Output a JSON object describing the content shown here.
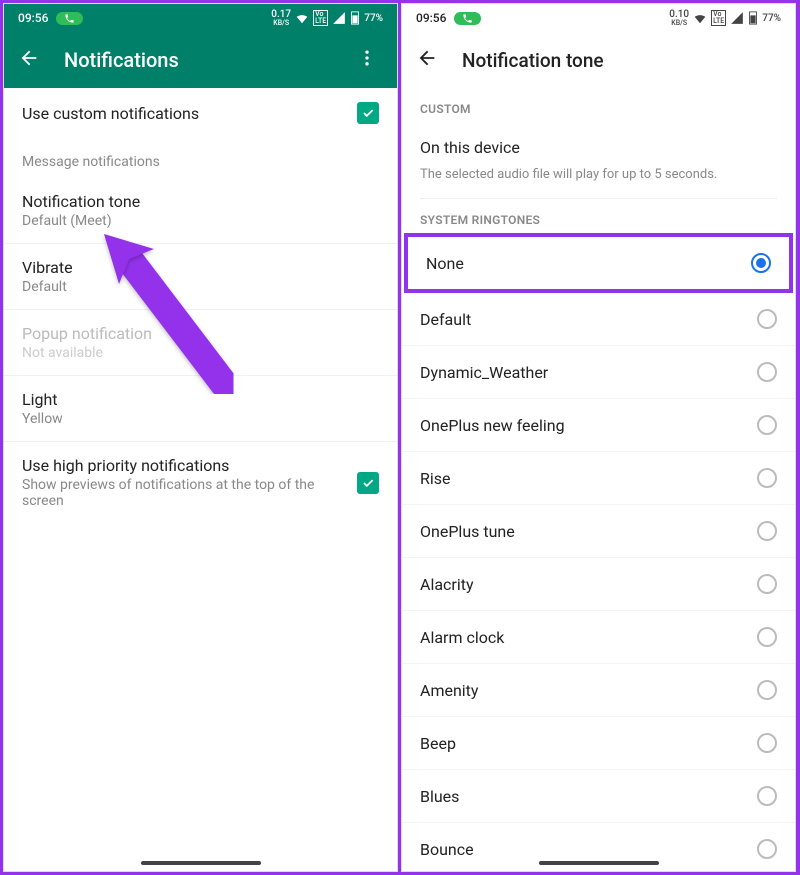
{
  "left": {
    "status": {
      "time": "09:56",
      "kbs": "0.17",
      "kbs_unit": "KB/S",
      "battery": "77%"
    },
    "appbar": {
      "title": "Notifications"
    },
    "useCustom": {
      "label": "Use custom notifications",
      "checked": true
    },
    "section1": "Message notifications",
    "items": [
      {
        "primary": "Notification tone",
        "secondary": "Default (Meet)",
        "disabled": false
      },
      {
        "primary": "Vibrate",
        "secondary": "Default",
        "disabled": false
      },
      {
        "primary": "Popup notification",
        "secondary": "Not available",
        "disabled": true
      },
      {
        "primary": "Light",
        "secondary": "Yellow",
        "disabled": false
      }
    ],
    "hpn": {
      "primary": "Use high priority notifications",
      "secondary": "Show previews of notifications at the top of the screen",
      "checked": true
    }
  },
  "right": {
    "status": {
      "time": "09:56",
      "kbs": "0.10",
      "kbs_unit": "KB/S",
      "battery": "77%"
    },
    "appbar": {
      "title": "Notification tone"
    },
    "customLabel": "CUSTOM",
    "custom": {
      "primary": "On this device",
      "secondary": "The selected audio file will play for up to 5 seconds."
    },
    "ringtonesLabel": "SYSTEM RINGTONES",
    "selected": "None",
    "tones": [
      "None",
      "Default",
      "Dynamic_Weather",
      "OnePlus new feeling",
      "Rise",
      "OnePlus tune",
      "Alacrity",
      "Alarm clock",
      "Amenity",
      "Beep",
      "Blues",
      "Bounce"
    ]
  }
}
